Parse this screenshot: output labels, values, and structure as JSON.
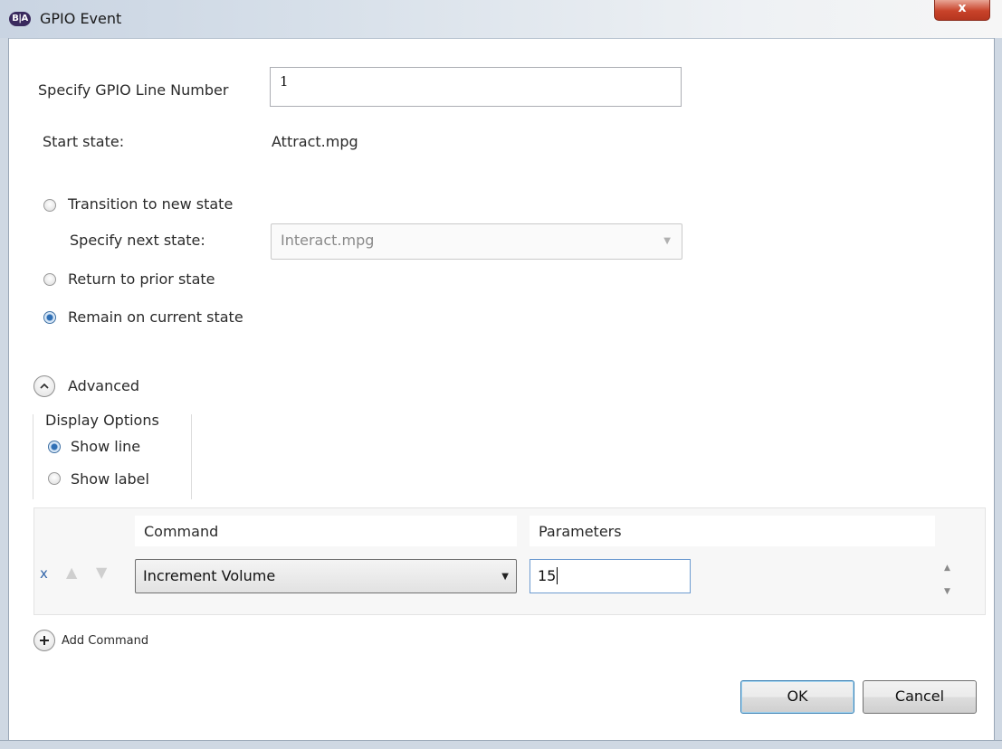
{
  "window": {
    "icon_text": "B|A",
    "title": "GPIO Event",
    "close_glyph": "x"
  },
  "form": {
    "gpio_label": "Specify GPIO Line Number",
    "gpio_value": "1",
    "start_state_label": "Start state:",
    "start_state_value": "Attract.mpg"
  },
  "transition": {
    "options": [
      {
        "label": "Transition to new state",
        "checked": false
      },
      {
        "label": "Return to prior state",
        "checked": false
      },
      {
        "label": "Remain on current state",
        "checked": true
      }
    ],
    "next_state_label": "Specify next state:",
    "next_state_value": "Interact.mpg"
  },
  "advanced": {
    "label": "Advanced",
    "display_options": {
      "title": "Display Options",
      "options": [
        {
          "label": "Show line",
          "checked": true
        },
        {
          "label": "Show label",
          "checked": false
        }
      ]
    }
  },
  "commands": {
    "headers": {
      "command": "Command",
      "parameters": "Parameters"
    },
    "rows": [
      {
        "remove": "x",
        "command": "Increment Volume",
        "parameters": "15"
      }
    ],
    "add_label": "Add Command"
  },
  "buttons": {
    "ok": "OK",
    "cancel": "Cancel"
  },
  "colors": {
    "accent": "#2f6fb5",
    "close_button": "#c8432a",
    "dialog_background": "#ffffff"
  }
}
